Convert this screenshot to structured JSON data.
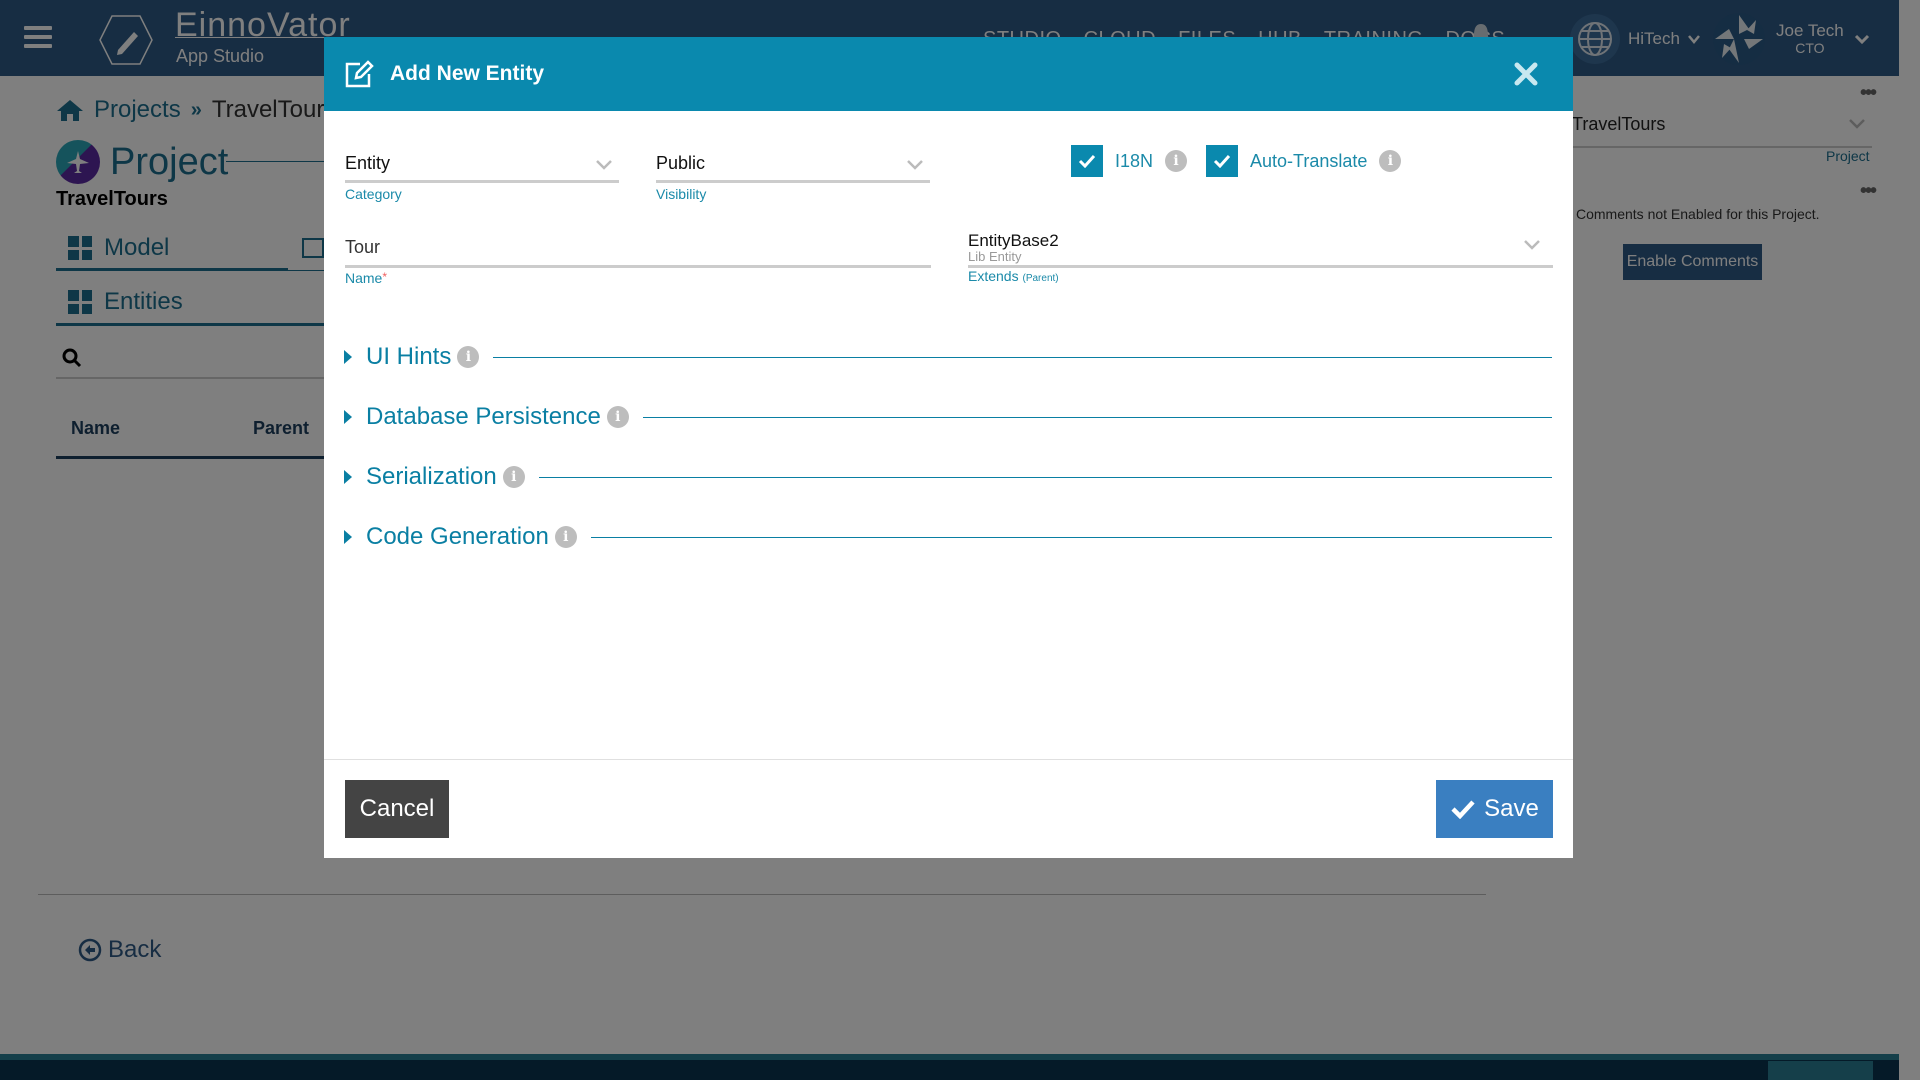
{
  "app": {
    "brand": "EinnoVator",
    "sub_brand": "App Studio",
    "nav": [
      "STUDIO",
      "CLOUD",
      "FILES",
      "HUB",
      "TRAINING",
      "DOCS"
    ],
    "org_name": "HiTech",
    "user_name": "Joe Tech",
    "user_role": "CTO"
  },
  "page": {
    "breadcrumb": {
      "projects": "Projects",
      "separator": "»",
      "current": "TravelTours"
    },
    "title": "Project",
    "project_name": "TravelTours",
    "tabs": {
      "model": "Model",
      "entities": "Entities"
    },
    "table_headers": {
      "name": "Name",
      "parent": "Parent"
    },
    "back_label": "Back"
  },
  "side_panel": {
    "project_value": "TravelTours",
    "project_label": "Project",
    "comments_note": "Comments not Enabled for this Project.",
    "enable_comments_label": "Enable Comments"
  },
  "modal": {
    "title": "Add New Entity",
    "category": {
      "value": "Entity",
      "label": "Category"
    },
    "visibility": {
      "value": "Public",
      "label": "Visibility"
    },
    "i18n": {
      "label": "I18N",
      "checked": true
    },
    "auto_translate": {
      "label": "Auto-Translate",
      "checked": true
    },
    "name": {
      "value": "Tour",
      "label": "Name",
      "required_mark": "*"
    },
    "extends": {
      "value": "EntityBase2",
      "sub_value": "Lib Entity",
      "label": "Extends",
      "label_hint": "(Parent)"
    },
    "sections": [
      "UI Hints",
      "Database Persistence",
      "Serialization",
      "Code Generation"
    ],
    "cancel_label": "Cancel",
    "save_label": "Save"
  },
  "colors": {
    "modal_header": "#0a89ae",
    "accent": "#1b8aa9",
    "save_button": "#3a7fc1",
    "cancel_button": "#444444",
    "topbar": "#2f5a86"
  }
}
